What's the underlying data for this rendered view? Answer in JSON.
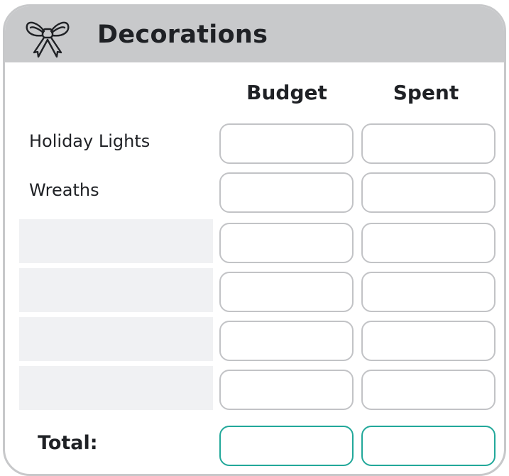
{
  "header": {
    "title": "Decorations",
    "icon": "bow-icon"
  },
  "columns": {
    "budget": "Budget",
    "spent": "Spent"
  },
  "rows": [
    {
      "label": "Holiday Lights",
      "budget": "",
      "spent": ""
    },
    {
      "label": "Wreaths",
      "budget": "",
      "spent": ""
    },
    {
      "label": "",
      "budget": "",
      "spent": ""
    },
    {
      "label": "",
      "budget": "",
      "spent": ""
    },
    {
      "label": "",
      "budget": "",
      "spent": ""
    },
    {
      "label": "",
      "budget": "",
      "spent": ""
    }
  ],
  "total": {
    "label": "Total:",
    "budget": "",
    "spent": ""
  },
  "colors": {
    "header_bg": "#c8c9cb",
    "border": "#c7c8ca",
    "box_border": "#c2c3c6",
    "total_accent": "#22a89a",
    "shade": "#f0f1f3",
    "text": "#1f2125"
  }
}
